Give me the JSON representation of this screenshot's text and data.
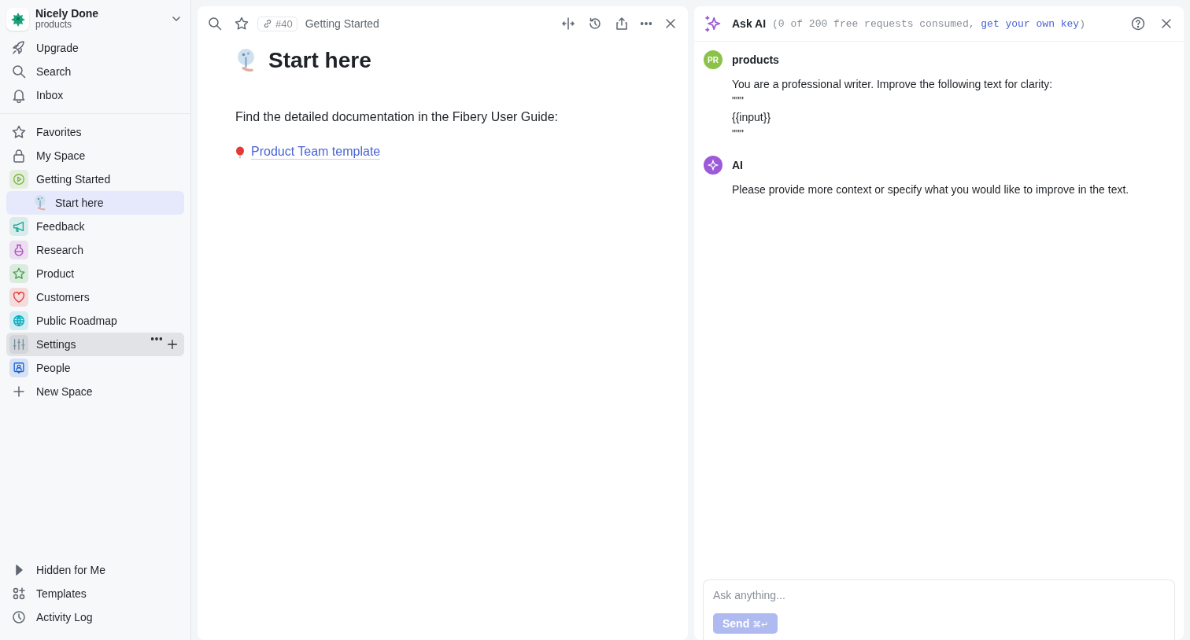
{
  "workspace": {
    "name": "Nicely Done",
    "subtitle": "products"
  },
  "nav": [
    {
      "label": "Upgrade",
      "kind": "rocket"
    },
    {
      "label": "Search",
      "kind": "search"
    },
    {
      "label": "Inbox",
      "kind": "bell"
    }
  ],
  "spaces": [
    {
      "label": "Favorites",
      "kind": "star",
      "selected": false,
      "hovered": false
    },
    {
      "label": "My Space",
      "kind": "lock",
      "selected": false,
      "hovered": false
    },
    {
      "label": "Getting Started",
      "kind": "play",
      "color": "#7cb342",
      "selected": false,
      "hovered": false,
      "children": [
        {
          "label": "Start here",
          "kind": "emoji",
          "selected": true,
          "hovered": false
        }
      ]
    },
    {
      "label": "Feedback",
      "kind": "megaphone",
      "color": "#26a69a",
      "selected": false,
      "hovered": false
    },
    {
      "label": "Research",
      "kind": "flask",
      "color": "#ab47bc",
      "selected": false,
      "hovered": false
    },
    {
      "label": "Product",
      "kind": "star",
      "color": "#43a047",
      "selected": false,
      "hovered": false
    },
    {
      "label": "Customers",
      "kind": "heart",
      "color": "#e53935",
      "selected": false,
      "hovered": false
    },
    {
      "label": "Public Roadmap",
      "kind": "globe",
      "color": "#00acc1",
      "selected": false,
      "hovered": false
    },
    {
      "label": "Settings",
      "kind": "sliders",
      "color": "#78909c",
      "selected": false,
      "hovered": true
    },
    {
      "label": "People",
      "kind": "person",
      "color": "#1e63d6",
      "selected": false,
      "hovered": false
    },
    {
      "label": "New Space",
      "kind": "plus",
      "selected": false,
      "hovered": false
    }
  ],
  "bottom": [
    {
      "label": "Hidden for Me",
      "kind": "triangle"
    },
    {
      "label": "Templates",
      "kind": "templates"
    },
    {
      "label": "Activity Log",
      "kind": "clock"
    }
  ],
  "document": {
    "id": "#40",
    "breadcrumb": "Getting Started",
    "title": "Start here",
    "paragraph": "Find the detailed documentation in the Fibery User Guide:",
    "link": "Product Team template"
  },
  "ai_panel": {
    "title": "Ask AI",
    "note": "(0 of 200 free requests consumed,",
    "note_link": "get your own key",
    "note_end": ")",
    "messages": [
      {
        "kind": "user",
        "avatar": "PR",
        "author": "products",
        "lines": [
          "You are a professional writer. Improve the following text for clarity:",
          "\"\"\"",
          "{{input}}",
          "\"\"\""
        ]
      },
      {
        "kind": "ai",
        "author": "AI",
        "lines": [
          "Please provide more context or specify what you would like to improve in the text."
        ]
      }
    ],
    "input": {
      "placeholder": "Ask anything..."
    },
    "send": {
      "label": "Send",
      "shortcut": "⌘↵",
      "disabled": true
    }
  }
}
